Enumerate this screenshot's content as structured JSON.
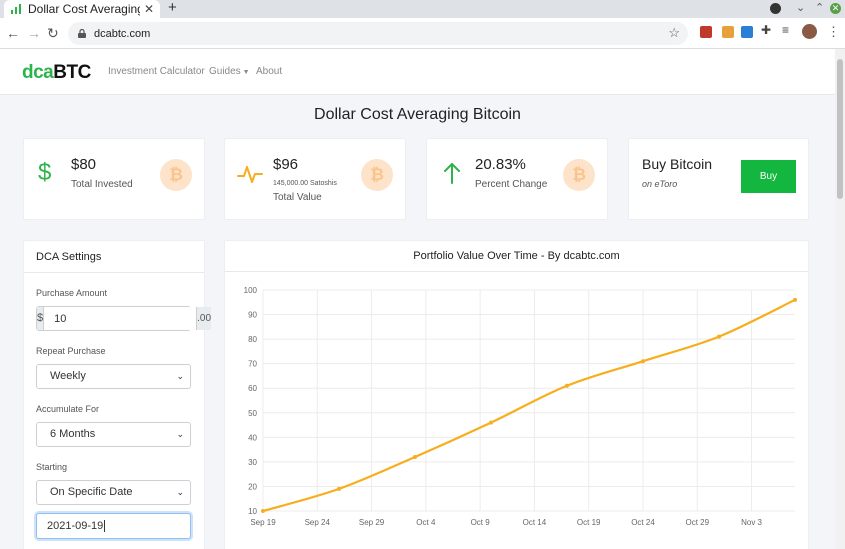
{
  "browser": {
    "tab_title": "Dollar Cost Averaging Bitcoin",
    "tab_close": "✕",
    "new_tab": "+",
    "url": "dcabtc.com"
  },
  "site": {
    "logo_part1": "dca",
    "logo_part2": "BTC",
    "nav": [
      "Investment Calculator",
      "Guides",
      "About"
    ],
    "page_title": "Dollar Cost Averaging Bitcoin"
  },
  "stats": {
    "invested": {
      "value": "$80",
      "label": "Total Invested",
      "icon": "dollar-icon"
    },
    "total_value": {
      "value": "$96",
      "sub": "145,000.00 Satoshis",
      "label": "Total Value",
      "icon": "pulse-icon"
    },
    "change": {
      "value": "20.83%",
      "label": "Percent Change",
      "icon": "arrow-up-icon"
    },
    "buy": {
      "title": "Buy Bitcoin",
      "sub": "on eToro",
      "button": "Buy"
    }
  },
  "settings": {
    "title": "DCA Settings",
    "purchase_amount_label": "Purchase Amount",
    "currency_prefix": "$",
    "amount": "10",
    "amount_suffix": ".00",
    "repeat_label": "Repeat Purchase",
    "repeat_value": "Weekly",
    "accumulate_label": "Accumulate For",
    "accumulate_value": "6 Months",
    "starting_label": "Starting",
    "starting_value": "On Specific Date",
    "date_value": "2021-09-19"
  },
  "colors": {
    "brand_green": "#2cb34a",
    "button_green": "#13b63e",
    "line": "#f7ae1d",
    "btc_coin_bg": "#fde3c9",
    "btc_coin_fg": "#fbc48c"
  },
  "chart_data": {
    "type": "line",
    "title": "Portfolio Value Over Time - By dcabtc.com",
    "ylim": [
      10,
      100
    ],
    "yticks": [
      10,
      20,
      30,
      40,
      50,
      60,
      70,
      80,
      90,
      100
    ],
    "xticks": [
      "Sep 19",
      "Sep 24",
      "Sep 29",
      "Oct 4",
      "Oct 9",
      "Oct 14",
      "Oct 19",
      "Oct 24",
      "Oct 29",
      "Nov 3"
    ],
    "grid": true,
    "series": [
      {
        "x": [
          "2021-09-19",
          "2021-09-26",
          "2021-10-03",
          "2021-10-10",
          "2021-10-17",
          "2021-10-24",
          "2021-10-31",
          "2021-11-07"
        ],
        "values": [
          10,
          19,
          32,
          46,
          61,
          71,
          81,
          96
        ]
      }
    ]
  }
}
